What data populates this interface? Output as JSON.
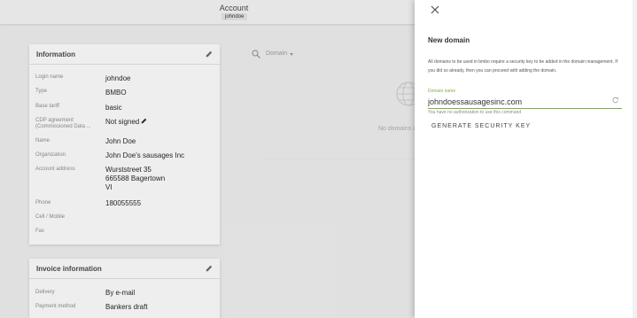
{
  "header": {
    "title": "Account",
    "username": "johndoe"
  },
  "information": {
    "title": "Information",
    "rows": [
      {
        "label": "Login name",
        "value": "johndoe"
      },
      {
        "label": "Type",
        "value": "BMBO"
      },
      {
        "label": "Base tariff",
        "value": "basic"
      },
      {
        "label": "CDP agreement (Commissioned Data ...",
        "value": "Not signed"
      },
      {
        "label": "Name",
        "value": "John Doe"
      },
      {
        "label": "Organization",
        "value": "John Doe's sausages Inc"
      },
      {
        "label": "Account address",
        "value": "Wurststreet 35\n665588 Bagertown\nVI"
      },
      {
        "label": "Phone",
        "value": "180055555"
      },
      {
        "label": "Cell / Mobile",
        "value": ""
      },
      {
        "label": "Fax",
        "value": ""
      }
    ]
  },
  "invoice": {
    "title": "Invoice information",
    "rows": [
      {
        "label": "Delivery",
        "value": "By e-mail"
      },
      {
        "label": "Payment method",
        "value": "Bankers draft"
      }
    ]
  },
  "domains": {
    "filter_label": "Domain",
    "empty_text": "No domains a"
  },
  "panel": {
    "title": "New domain",
    "description": "All domains to be used in bmbo require a security key to be added in the domain management. If you did so already, then you can proceed with adding the domain.",
    "field_label": "Domain name",
    "field_value": "johndoessausagesinc.com",
    "hint": "You have no authorization to use this command",
    "button": "GENERATE SECURITY KEY"
  },
  "colors": {
    "accent": "#7fae45"
  }
}
